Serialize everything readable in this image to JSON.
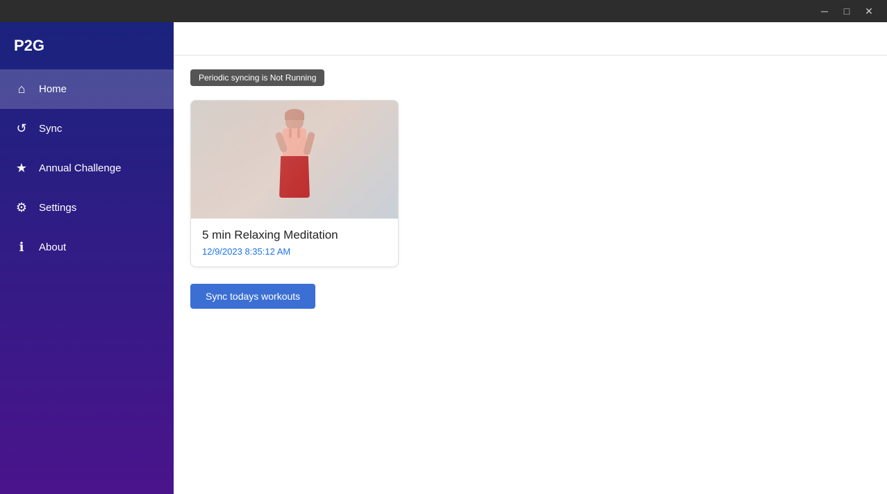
{
  "titlebar": {
    "title": "",
    "minimize_label": "─",
    "maximize_label": "□",
    "close_label": "✕"
  },
  "sidebar": {
    "logo": "P2G",
    "items": [
      {
        "id": "home",
        "label": "Home",
        "icon": "⌂",
        "active": true
      },
      {
        "id": "sync",
        "label": "Sync",
        "icon": "↺",
        "active": false
      },
      {
        "id": "annual-challenge",
        "label": "Annual Challenge",
        "icon": "★",
        "active": false
      },
      {
        "id": "settings",
        "label": "Settings",
        "icon": "⚙",
        "active": false
      },
      {
        "id": "about",
        "label": "About",
        "icon": "ℹ",
        "active": false
      }
    ]
  },
  "main": {
    "status_badge": "Periodic syncing is Not Running",
    "workout": {
      "title": "5 min Relaxing Meditation",
      "date": "12/9/2023 8:35:12 AM"
    },
    "sync_button_label": "Sync todays workouts"
  }
}
